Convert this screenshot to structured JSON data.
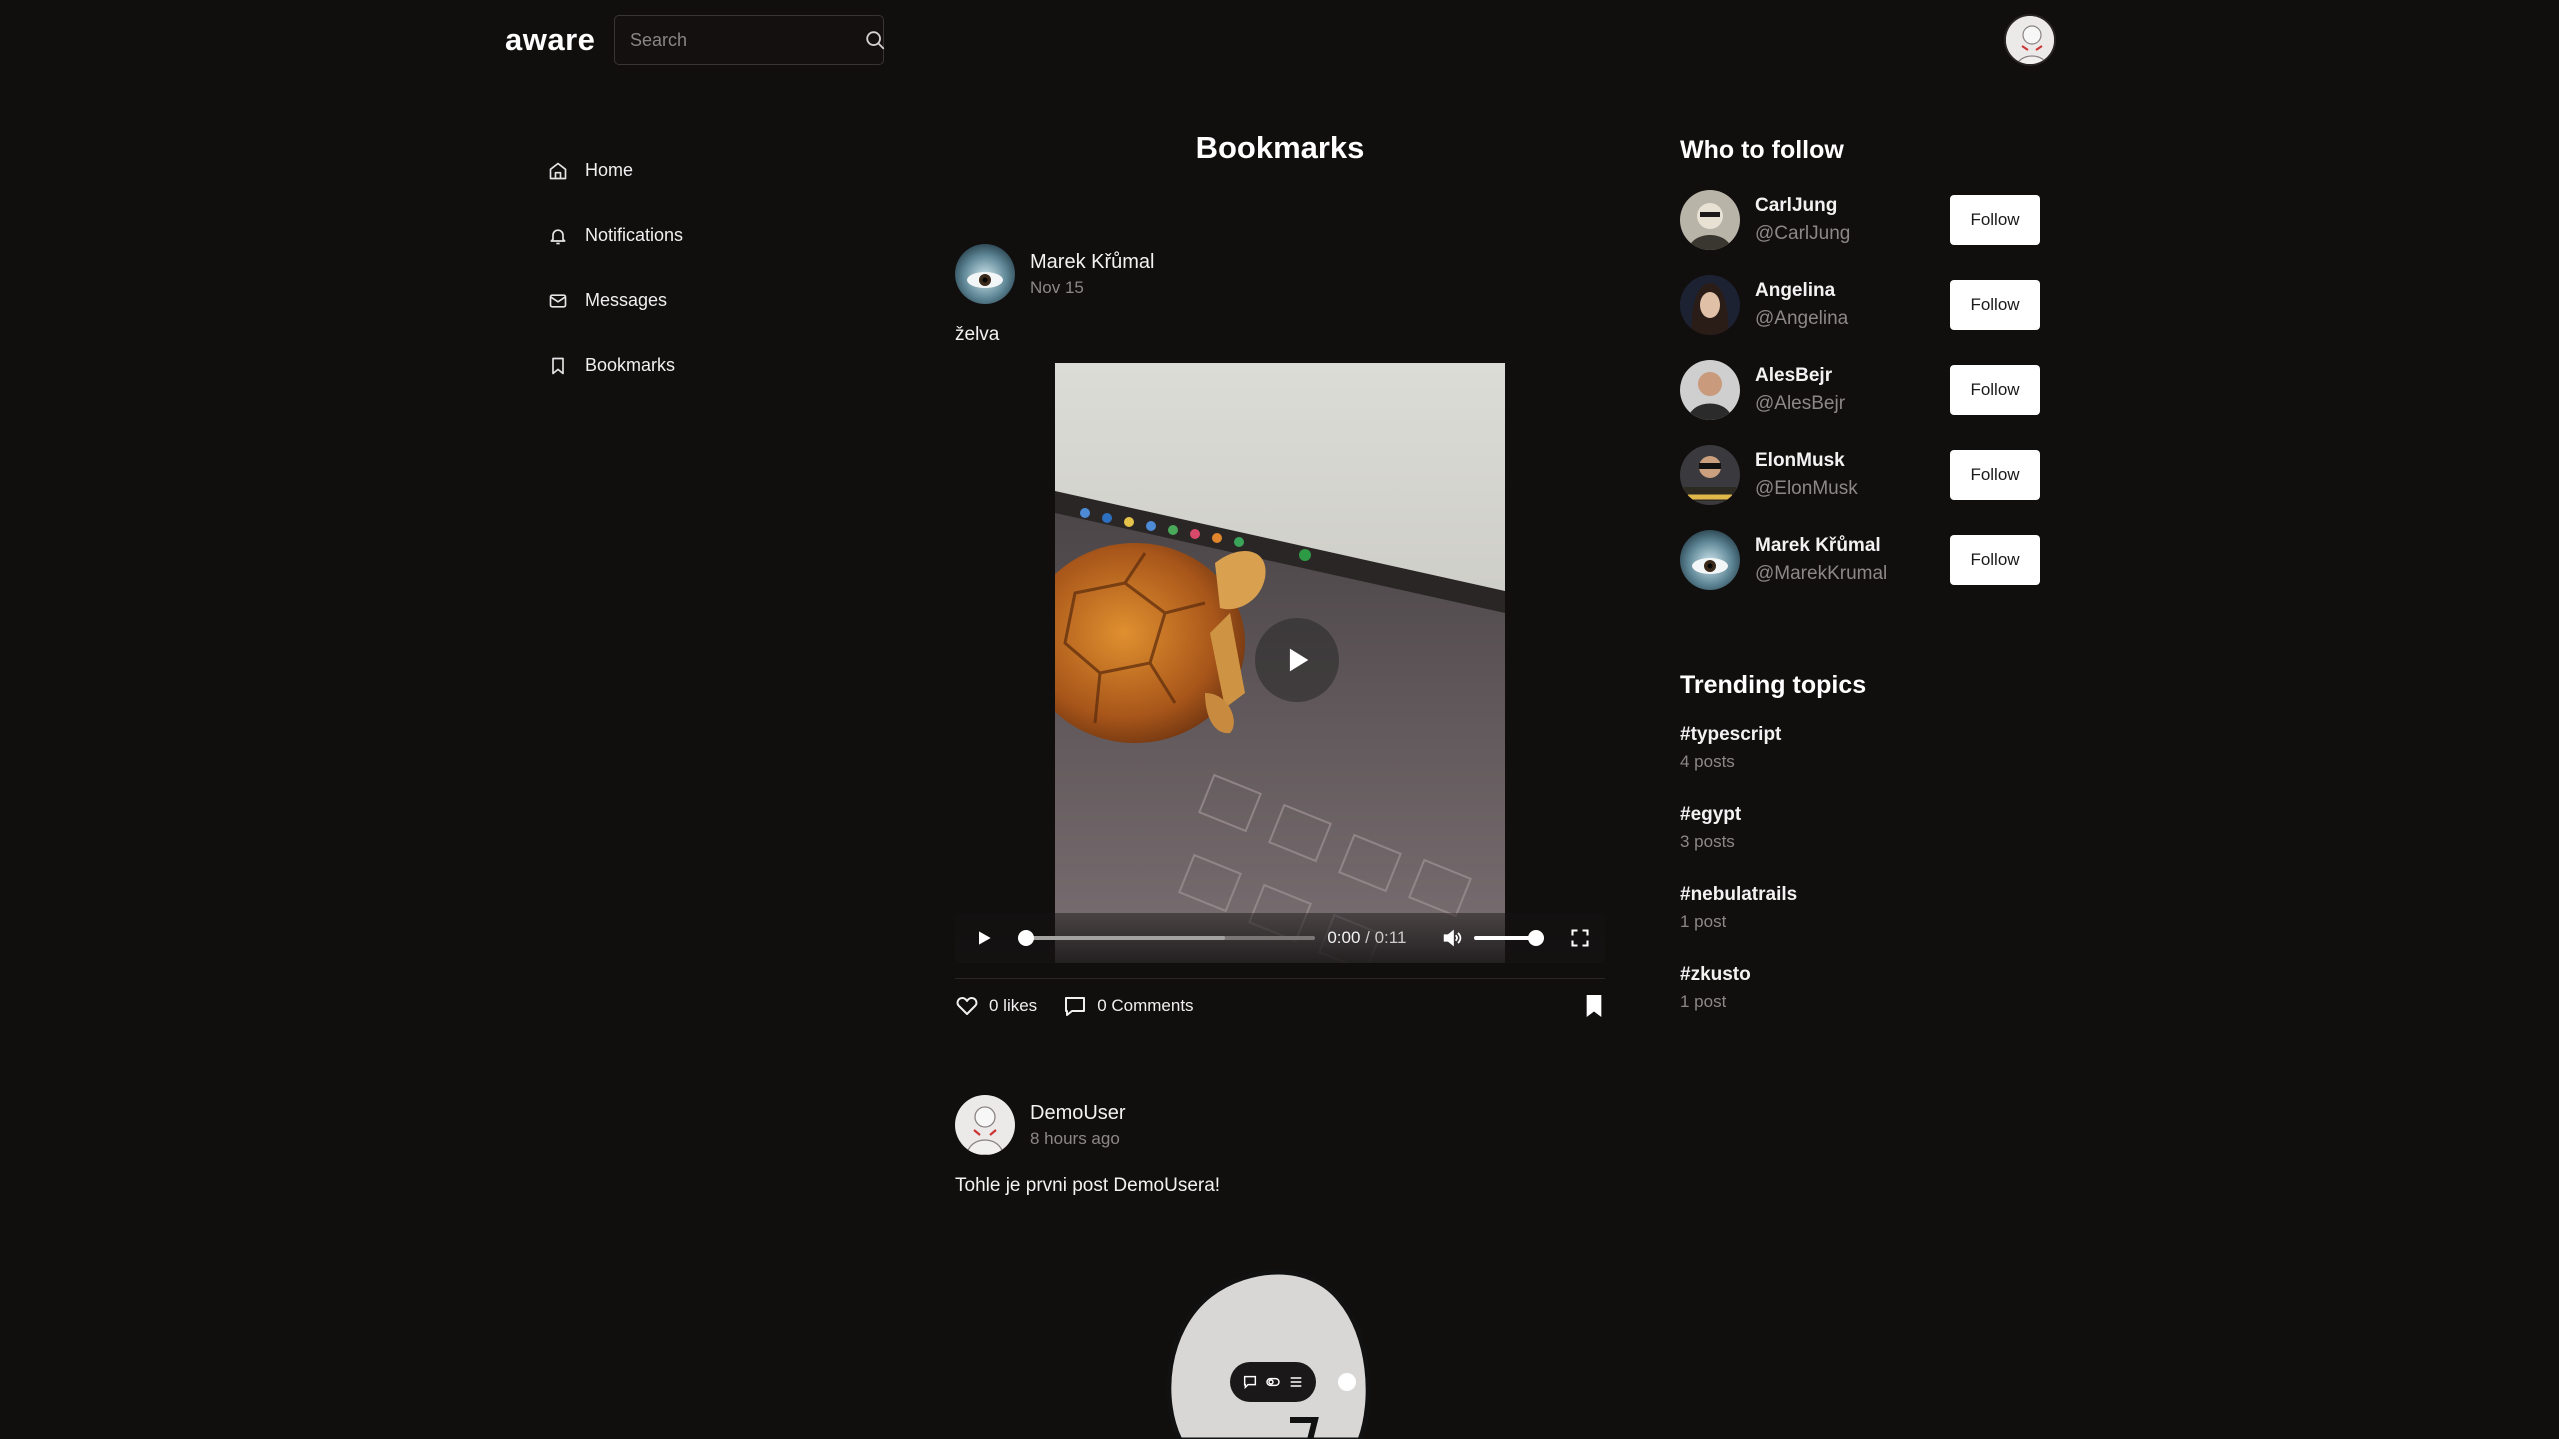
{
  "app": {
    "logo": "aware",
    "search_placeholder": "Search"
  },
  "nav": {
    "items": [
      {
        "label": "Home",
        "icon": "home-icon"
      },
      {
        "label": "Notifications",
        "icon": "bell-icon"
      },
      {
        "label": "Messages",
        "icon": "mail-icon"
      },
      {
        "label": "Bookmarks",
        "icon": "bookmark-icon"
      }
    ]
  },
  "main": {
    "title": "Bookmarks",
    "posts": [
      {
        "author": "Marek Křůmal",
        "date": "Nov 15",
        "text": "želva",
        "video": {
          "current": "0:00",
          "separator": " / ",
          "duration": "0:11",
          "progress": 0.0,
          "buffered": 0.68,
          "volume": 1.0
        },
        "likes": "0 likes",
        "comments": "0 Comments",
        "bookmarked": true
      },
      {
        "author": "DemoUser",
        "date": "8 hours ago",
        "text": "Tohle je prvni post DemoUsera!"
      }
    ]
  },
  "who_to_follow": {
    "title": "Who to follow",
    "users": [
      {
        "name": "CarlJung",
        "handle": "@CarlJung",
        "button": "Follow"
      },
      {
        "name": "Angelina",
        "handle": "@Angelina",
        "button": "Follow"
      },
      {
        "name": "AlesBejr",
        "handle": "@AlesBejr",
        "button": "Follow"
      },
      {
        "name": "ElonMusk",
        "handle": "@ElonMusk",
        "button": "Follow"
      },
      {
        "name": "Marek Křůmal",
        "handle": "@MarekKrumal",
        "button": "Follow"
      }
    ]
  },
  "trending": {
    "title": "Trending topics",
    "topics": [
      {
        "tag": "#typescript",
        "count": "4 posts"
      },
      {
        "tag": "#egypt",
        "count": "3 posts"
      },
      {
        "tag": "#nebulatrails",
        "count": "1 post"
      },
      {
        "tag": "#zkusto",
        "count": "1 post"
      }
    ]
  },
  "colors": {
    "background": "#110e0e",
    "text": "#f2f2f2",
    "muted": "#8d8888",
    "button_bg": "#ffffff"
  }
}
